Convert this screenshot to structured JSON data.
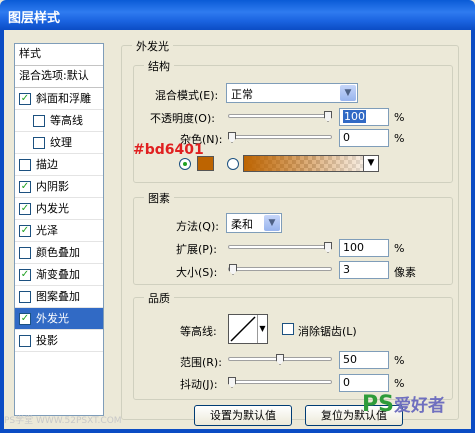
{
  "window": {
    "title": "图层样式"
  },
  "sidebar": {
    "header": "样式",
    "blending": "混合选项:默认",
    "items": [
      {
        "label": "斜面和浮雕",
        "checked": true,
        "sub": false
      },
      {
        "label": "等高线",
        "checked": false,
        "sub": true
      },
      {
        "label": "纹理",
        "checked": false,
        "sub": true
      },
      {
        "label": "描边",
        "checked": false,
        "sub": false
      },
      {
        "label": "内阴影",
        "checked": true,
        "sub": false
      },
      {
        "label": "内发光",
        "checked": true,
        "sub": false
      },
      {
        "label": "光泽",
        "checked": true,
        "sub": false
      },
      {
        "label": "颜色叠加",
        "checked": false,
        "sub": false
      },
      {
        "label": "渐变叠加",
        "checked": true,
        "sub": false
      },
      {
        "label": "图案叠加",
        "checked": false,
        "sub": false
      },
      {
        "label": "外发光",
        "checked": true,
        "sub": false,
        "selected": true
      },
      {
        "label": "投影",
        "checked": false,
        "sub": false
      }
    ]
  },
  "panel": {
    "title": "外发光",
    "structure": {
      "title": "结构",
      "blend_mode_label": "混合模式(E):",
      "blend_mode_value": "正常",
      "opacity_label": "不透明度(O):",
      "opacity_value": "100",
      "opacity_fraction": 1.0,
      "noise_label": "杂色(N):",
      "noise_value": "0",
      "noise_fraction": 0.0,
      "percent": "%",
      "color": "#bd6401",
      "annotation": "#bd6401"
    },
    "elements": {
      "title": "图素",
      "technique_label": "方法(Q):",
      "technique_value": "柔和",
      "spread_label": "扩展(P):",
      "spread_value": "100",
      "spread_fraction": 1.0,
      "size_label": "大小(S):",
      "size_value": "3",
      "size_fraction": 0.01,
      "percent": "%",
      "pixels": "像素"
    },
    "quality": {
      "title": "品质",
      "contour_label": "等高线:",
      "antialias_label": "消除锯齿(L)",
      "range_label": "范围(R):",
      "range_value": "50",
      "range_fraction": 0.5,
      "jitter_label": "抖动(J):",
      "jitter_value": "0",
      "jitter_fraction": 0.0,
      "percent": "%"
    },
    "buttons": {
      "make_default": "设置为默认值",
      "reset_default": "复位为默认值"
    }
  },
  "watermarks": {
    "left": "PS学堂 WWW.52PSXT.COM",
    "right_main": "PS",
    "right_sub": "爱好者"
  }
}
